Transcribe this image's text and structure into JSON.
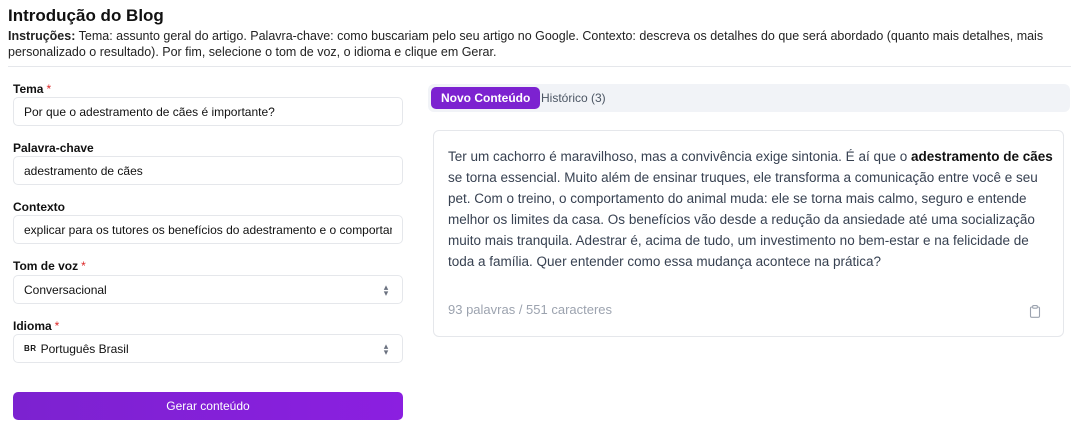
{
  "header": {
    "title": "Introdução do Blog",
    "instructions_label": "Instruções:",
    "instructions_text": " Tema: assunto geral do artigo. Palavra-chave: como buscariam pelo seu artigo no Google. Contexto: descreva os detalhes do que será abordado (quanto mais detalhes, mais personalizado o resultado). Por fim, selecione o tom de voz, o idioma e clique em Gerar."
  },
  "form": {
    "tema": {
      "label": "Tema",
      "required": "*",
      "value": "Por que o adestramento de cães é importante?"
    },
    "palavra_chave": {
      "label": "Palavra-chave",
      "value": "adestramento de cães"
    },
    "contexto": {
      "label": "Contexto",
      "value": "explicar para os tutores os benefícios do adestramento e o comportamento"
    },
    "tom_de_voz": {
      "label": "Tom de voz",
      "required": "*",
      "value": "Conversacional"
    },
    "idioma": {
      "label": "Idioma",
      "required": "*",
      "flag": "BR",
      "value": "Português Brasil"
    },
    "submit_label": "Gerar conteúdo"
  },
  "tabs": [
    {
      "label": "Novo Conteúdo",
      "active": true
    },
    {
      "label": "Histórico (3)",
      "active": false
    }
  ],
  "result": {
    "text_before": "Ter um cachorro é maravilhoso, mas a convivência exige sintonia. É aí que o ",
    "text_bold": "adestramento de cães",
    "text_after": " se torna essencial. Muito além de ensinar truques, ele transforma a comunicação entre você e seu pet. Com o treino, o comportamento do animal muda: ele se torna mais calmo, seguro e entende melhor os limites da casa. Os benefícios vão desde a redução da ansiedade até uma socialização muito mais tranquila. Adestrar é, acima de tudo, um investimento no bem-estar e na felicidade de toda a família. Quer entender como essa mudança acontece na prática?",
    "counter": "93 palavras / 551 caracteres"
  },
  "icons": {
    "copy": "clipboard-icon",
    "select": "chevron-updown-icon"
  },
  "colors": {
    "accent": "#7c22d0",
    "required": "#dc2626"
  }
}
